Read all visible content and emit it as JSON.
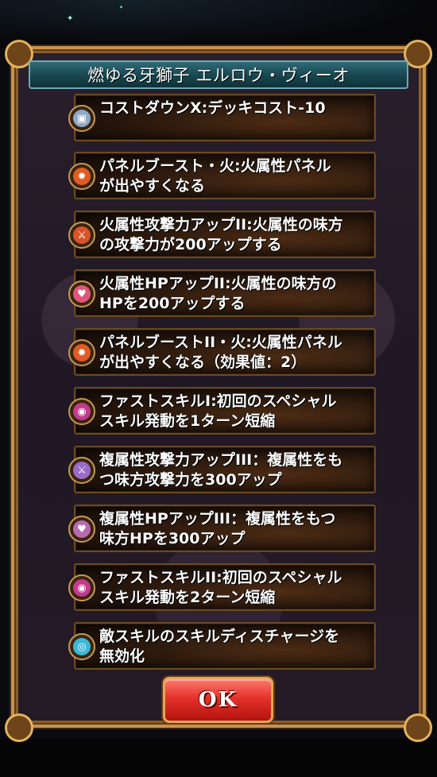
{
  "dialog": {
    "title": "燃ゆる牙獅子 エルロウ・ヴィーオ",
    "ok_label": "OK"
  },
  "skills": [
    {
      "text": "コストダウンX:デッキコスト-10",
      "icon": "cost-down-icon",
      "color": "#8fa8c8"
    },
    {
      "text": "パネルブースト・火:火属性パネル\nが出やすくなる",
      "icon": "fire-panel-icon",
      "color": "#e25b22"
    },
    {
      "text": "火属性攻撃力アップII:火属性の味方\nの攻撃力が200アップする",
      "icon": "fire-attack-icon",
      "color": "#d9532a"
    },
    {
      "text": "火属性HPアップII:火属性の味方の\nHPを200アップする",
      "icon": "fire-hp-icon",
      "color": "#e0567a"
    },
    {
      "text": "パネルブーストII・火:火属性パネル\nが出やすくなる（効果値：2）",
      "icon": "fire-panel-icon",
      "color": "#e25b22"
    },
    {
      "text": "ファストスキルI:初回のスペシャル\nスキル発動を1ターン短縮",
      "icon": "fast-skill-icon",
      "color": "#c23b8e"
    },
    {
      "text": "複属性攻撃力アップIII：複属性をも\nつ味方攻撃力を300アップ",
      "icon": "multi-attack-icon",
      "color": "#9a6bc8"
    },
    {
      "text": "複属性HPアップIII：複属性をもつ\n味方HPを300アップ",
      "icon": "multi-hp-icon",
      "color": "#b86ab0"
    },
    {
      "text": "ファストスキルII:初回のスペシャル\nスキル発動を2ターン短縮",
      "icon": "fast-skill-icon",
      "color": "#c23b8e"
    },
    {
      "text": "敵スキルのスキルディスチャージを\n無効化",
      "icon": "discharge-guard-icon",
      "color": "#3bb8d8"
    }
  ]
}
